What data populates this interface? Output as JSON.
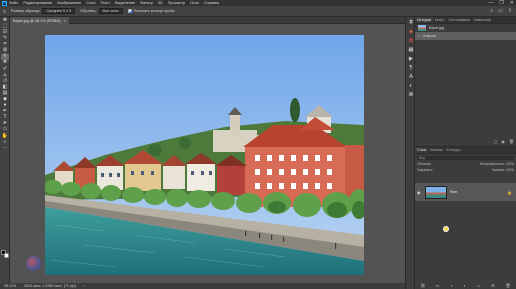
{
  "menubar": {
    "items": [
      "Файл",
      "Редактирование",
      "Изображение",
      "Слои",
      "Текст",
      "Выделение",
      "Фильтр",
      "3D",
      "Просмотр",
      "Окно",
      "Справка"
    ],
    "controls": [
      "—",
      "❐",
      "✕"
    ]
  },
  "options": {
    "size_label": "Размер образца:",
    "size_value": "Среднее 5 х 5",
    "sample_label": "Образец:",
    "sample_value": "Все слои",
    "show_ring_label": "Показать кольцо пробы"
  },
  "document": {
    "tab_title": "Берег.jpg @ 28,1% (RGB/8)",
    "close": "×"
  },
  "status": {
    "zoom": "28,12%",
    "doc_info": "3000 пикс. x 2250 пикс. (72 ppi)"
  },
  "history_panel": {
    "tabs": [
      "История",
      "Инфо",
      "Гистограмма",
      "Навигатор"
    ],
    "rows": [
      "Берег.jpg",
      "Открыть"
    ]
  },
  "layers_panel": {
    "tabs": [
      "Слои",
      "Каналы",
      "Контуры"
    ],
    "filter_label": "Вид",
    "blend_mode": "Обычные",
    "opacity_label": "Непрозрачность:",
    "opacity_value": "100%",
    "lock_label": "Закрепить:",
    "fill_label": "Заливка:",
    "fill_value": "100%",
    "layer_name": "Фон"
  },
  "colors": {
    "accent": "#1473e6",
    "app_bg": "#535353",
    "panel_bg": "#3c3c3c",
    "ps_logo": "#31a8ff"
  }
}
